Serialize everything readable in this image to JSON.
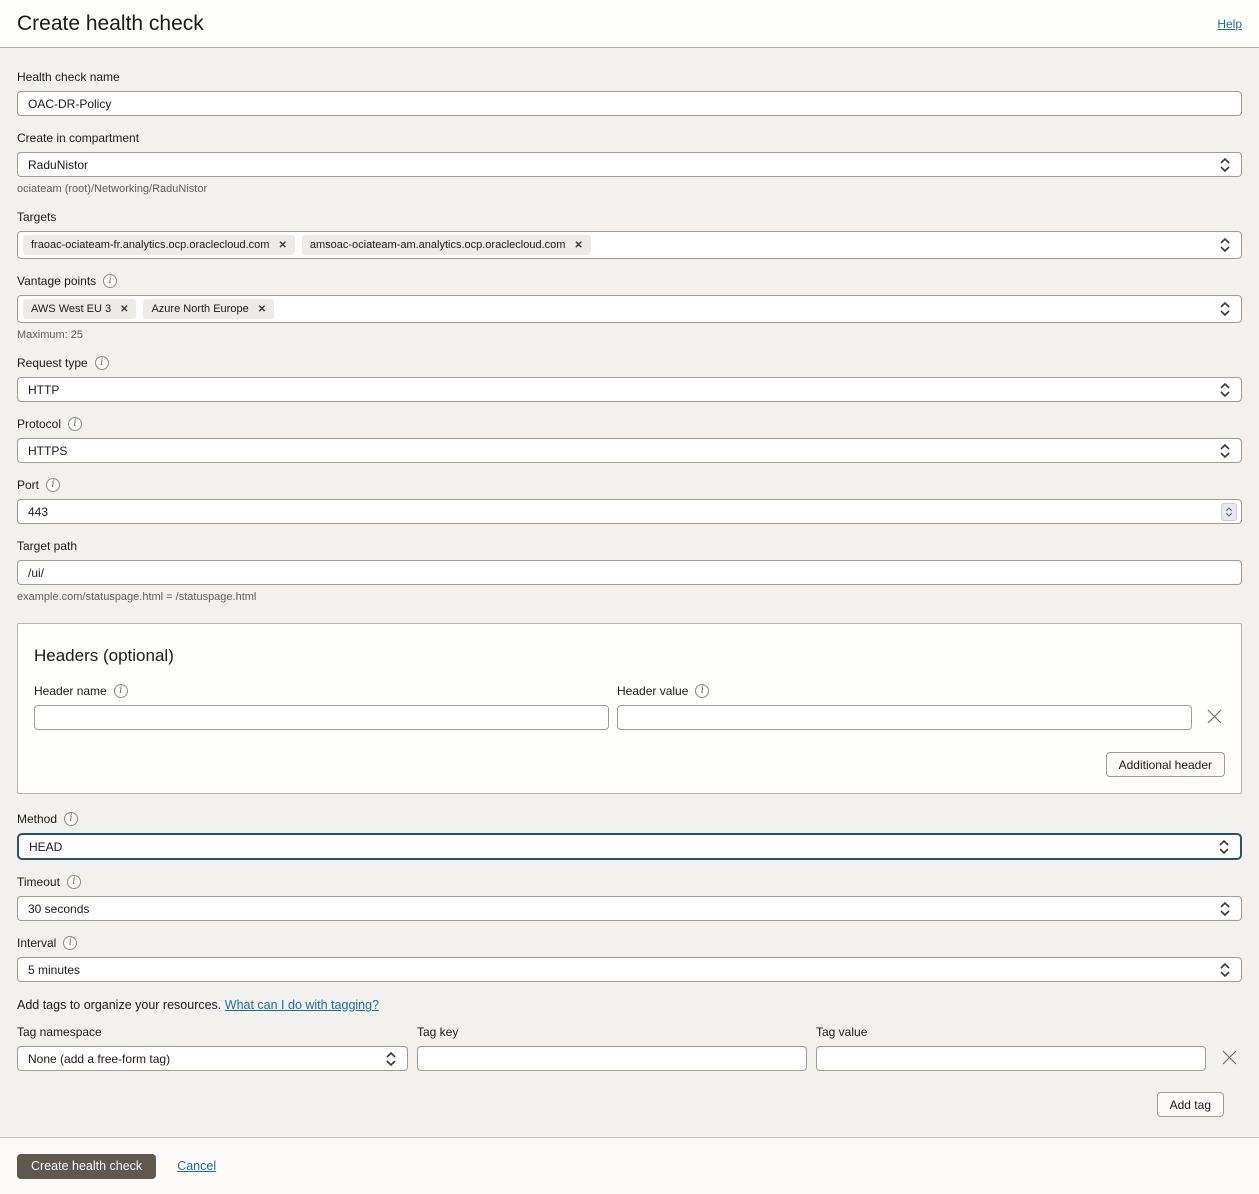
{
  "header": {
    "title": "Create health check",
    "help_label": "Help"
  },
  "form": {
    "name": {
      "label": "Health check name",
      "value": "OAC-DR-Policy"
    },
    "compartment": {
      "label": "Create in compartment",
      "value": "RaduNistor",
      "hint": "ociateam (root)/Networking/RaduNistor"
    },
    "targets": {
      "label": "Targets",
      "chips": [
        "fraoac-ociateam-fr.analytics.ocp.oraclecloud.com",
        "amsoac-ociateam-am.analytics.ocp.oraclecloud.com"
      ]
    },
    "vantage_points": {
      "label": "Vantage points",
      "chips": [
        "AWS West EU 3",
        "Azure North Europe"
      ],
      "hint": "Maximum: 25"
    },
    "request_type": {
      "label": "Request type",
      "value": "HTTP"
    },
    "protocol": {
      "label": "Protocol",
      "value": "HTTPS"
    },
    "port": {
      "label": "Port",
      "value": "443"
    },
    "target_path": {
      "label": "Target path",
      "value": "/ui/",
      "hint": "example.com/statuspage.html = /statuspage.html"
    },
    "headers_section": {
      "title": "Headers (optional)",
      "header_name": {
        "label": "Header name",
        "value": ""
      },
      "header_value": {
        "label": "Header value",
        "value": ""
      },
      "additional_header_button": "Additional header"
    },
    "method": {
      "label": "Method",
      "value": "HEAD"
    },
    "timeout": {
      "label": "Timeout",
      "value": "30 seconds"
    },
    "interval": {
      "label": "Interval",
      "value": "5 minutes"
    },
    "tags": {
      "intro": "Add tags to organize your resources.",
      "link": "What can I do with tagging?",
      "namespace": {
        "label": "Tag namespace",
        "value": "None (add a free-form tag)"
      },
      "key": {
        "label": "Tag key",
        "value": ""
      },
      "value": {
        "label": "Tag value",
        "value": ""
      },
      "add_tag_button": "Add tag"
    }
  },
  "footer": {
    "create_button": "Create health check",
    "cancel_label": "Cancel"
  },
  "icons": {
    "info": "i",
    "chip_close": "✕"
  },
  "colors": {
    "page_bg": "#f2f1ee",
    "link": "#1e6f9c",
    "focus_border": "#2a5266",
    "primary_button_bg": "#5e584f",
    "chip_bg": "#ecebe8",
    "input_border": "#a19b92"
  }
}
